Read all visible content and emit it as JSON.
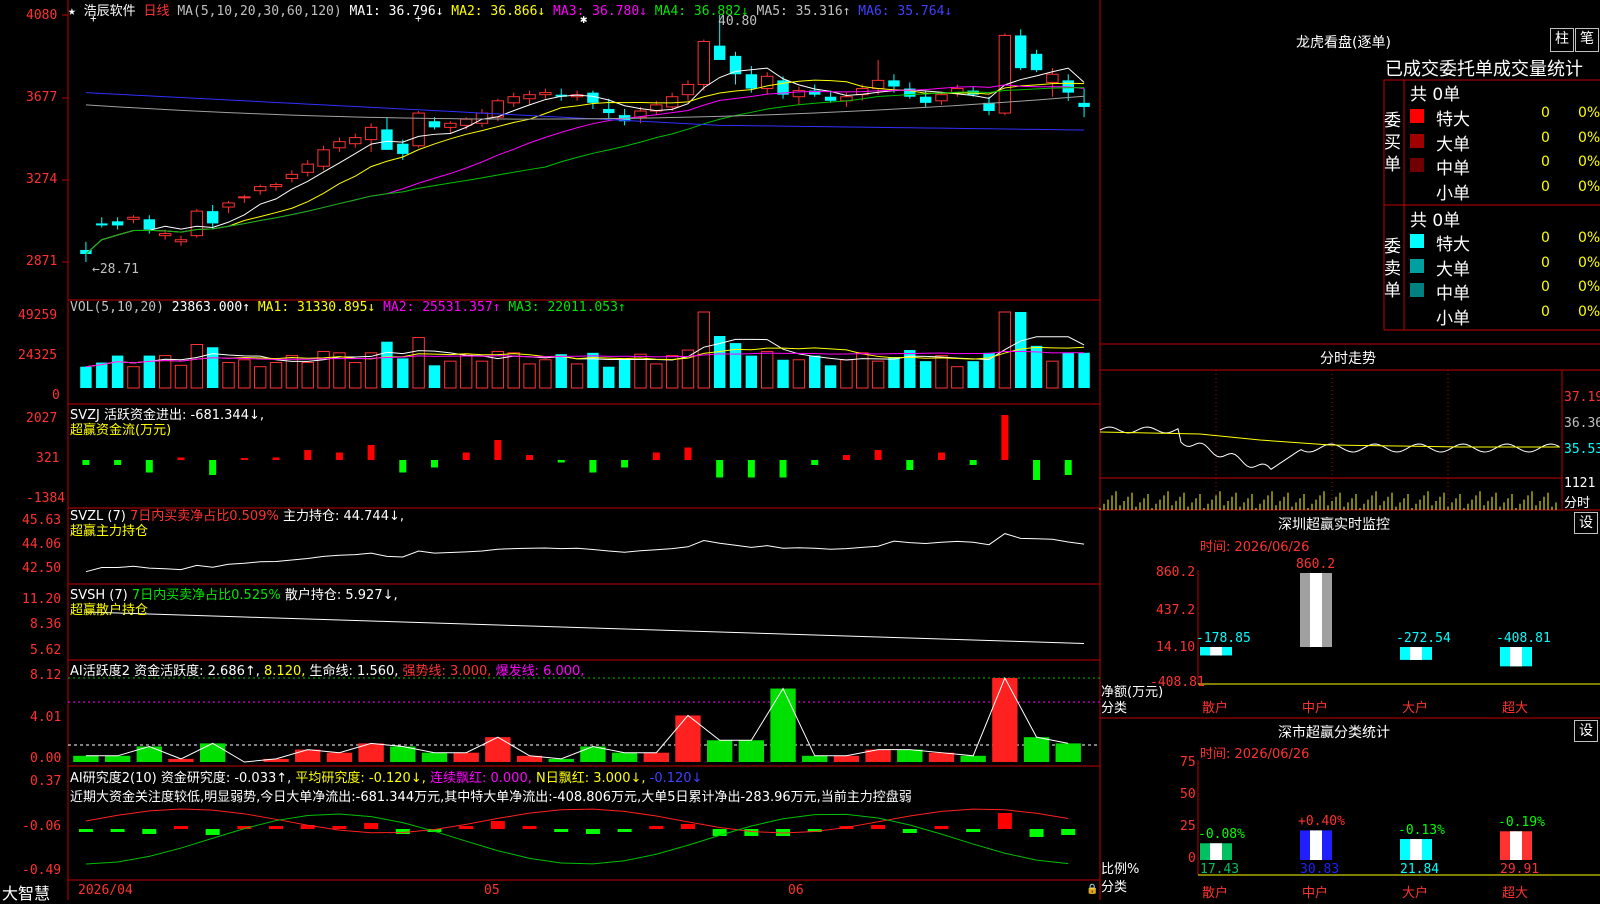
{
  "stock": {
    "name": "浩辰软件",
    "period": "日线",
    "star": "★",
    "star2": "✱"
  },
  "ma_bar": {
    "label": "MA(5,10,20,30,60,120)",
    "ma1": "MA1: 36.796↓",
    "ma2": "MA2: 36.866↓",
    "ma3": "MA3: 36.780↓",
    "ma4": "MA4: 36.882↓",
    "ma5": "MA5: 35.316↑",
    "ma6": "MA6: 35.764↓"
  },
  "price_axis": [
    "4080",
    "3677",
    "3274",
    "2871"
  ],
  "price_marks": {
    "high": "40.80",
    "low": "28.71"
  },
  "vol": {
    "label": "VOL(5,10,20)",
    "value": "23863.000↑",
    "ma1": "MA1: 31330.895↓",
    "ma2": "MA2: 25531.357↑",
    "ma3": "MA3: 22011.053↑",
    "axis": [
      "49259",
      "24325",
      "0"
    ]
  },
  "svzj": {
    "label": "SVZJ  活跃资金进出: -681.344↓,",
    "sub": "超赢资金流(万元)",
    "axis": [
      "2027",
      "321",
      "-1384"
    ]
  },
  "svzl": {
    "label": "SVZL (7)",
    "p1": "7日内买卖净占比0.509%",
    "p2": "主力持仓: 44.744↓,",
    "sub": "超赢主力持仓",
    "axis": [
      "45.63",
      "44.06",
      "42.50"
    ]
  },
  "svsh": {
    "label": "SVSH (7)",
    "p1": "7日内买卖净占比0.525%",
    "p2": "散户持仓: 5.927↓,",
    "sub": "超赢散户持仓",
    "axis": [
      "11.20",
      "8.36",
      "5.62"
    ]
  },
  "ai_active": {
    "label": "AI活跃度2 资金活跃度: 2.686↑,",
    "v2": "8.120,",
    "v3": "生命线: 1.560,",
    "v4": "强势线: 3.000,",
    "v5": "爆发线: 6.000,",
    "axis": [
      "8.12",
      "4.01",
      "0.00"
    ]
  },
  "ai_research": {
    "label": "AI研究度2(10) 资金研究度: -0.033↑,",
    "v2": "平均研究度: -0.120↓,",
    "v3": "连续飘红: 0.000,",
    "v4": "N日飘红: 3.000↓,",
    "v5": "-0.120↓",
    "summary": "近期大资金关注度较低,明显弱势,今日大单净流出:-681.344万元,其中特大单净流出:-408.806万元,大单5日累计净出-283.96万元,当前主力控盘弱",
    "axis": [
      "0.37",
      "-0.06",
      "-0.49"
    ]
  },
  "dates": {
    "d1": "2026/04",
    "d2": "05",
    "d3": "06"
  },
  "brand": "大智慧",
  "right": {
    "lh_title": "龙虎看盘(逐单)",
    "btn_zhu": "柱",
    "btn_bi": "笔",
    "header": "已成交委托单成交量统计",
    "buy": {
      "side": "委买单",
      "count": "共 0单",
      "rows": [
        {
          "name": "特大",
          "v": "0",
          "p": "0%",
          "c": "#ff0000"
        },
        {
          "name": "大单",
          "v": "0",
          "p": "0%",
          "c": "#a00000"
        },
        {
          "name": "中单",
          "v": "0",
          "p": "0%",
          "c": "#700000"
        },
        {
          "name": "小单",
          "v": "0",
          "p": "0%",
          "c": ""
        }
      ]
    },
    "sell": {
      "side": "委卖单",
      "count": "共 0单",
      "rows": [
        {
          "name": "特大",
          "v": "0",
          "p": "0%",
          "c": "#00ffff"
        },
        {
          "name": "大单",
          "v": "0",
          "p": "0%",
          "c": "#00a0a0"
        },
        {
          "name": "中单",
          "v": "0",
          "p": "0%",
          "c": "#008080"
        },
        {
          "name": "小单",
          "v": "0",
          "p": "0%",
          "c": ""
        }
      ]
    },
    "fs": {
      "title": "分时走势",
      "axis": [
        "37.19",
        "36.36",
        "35.53"
      ],
      "vol": "1121",
      "vol_unit": "分时"
    },
    "sz": {
      "title": "深圳超赢实时监控",
      "btn": "设",
      "time": "时间: 2026/06/26",
      "axis": [
        "860.2",
        "437.2",
        "14.10",
        "-408.81"
      ],
      "ylabel": "净额(万元)",
      "xlabel": "分类",
      "cats": [
        "散户",
        "中户",
        "大户",
        "超大"
      ],
      "values": [
        "-178.85",
        "860.2",
        "-272.54",
        "-408.81"
      ]
    },
    "sc": {
      "title": "深市超赢分类统计",
      "btn": "设",
      "time": "时间: 2026/06/26",
      "axis": [
        "75",
        "50",
        "25",
        "0"
      ],
      "ylabel": "比例%",
      "xlabel": "分类",
      "cats": [
        "散户",
        "中户",
        "大户",
        "超大"
      ],
      "chg": [
        "-0.08%",
        "+0.40%",
        "-0.13%",
        "-0.19%"
      ],
      "vals": [
        "17.43",
        "30.83",
        "21.84",
        "29.91"
      ]
    }
  },
  "chart_data": {
    "type": "candlestick",
    "title": "浩辰软件 日线",
    "ylim": [
      28.71,
      40.8
    ],
    "candles": [
      [
        29.3,
        29.7,
        28.71,
        29.1
      ],
      [
        30.6,
        30.9,
        30.4,
        30.5
      ],
      [
        30.7,
        30.9,
        30.3,
        30.5
      ],
      [
        30.8,
        31.0,
        30.6,
        30.9
      ],
      [
        30.8,
        31.0,
        30.1,
        30.3
      ],
      [
        30.0,
        30.3,
        29.8,
        30.1
      ],
      [
        29.7,
        30.0,
        29.5,
        29.8
      ],
      [
        30.0,
        31.3,
        29.9,
        31.2
      ],
      [
        31.2,
        31.5,
        30.3,
        30.6
      ],
      [
        31.4,
        31.7,
        31.1,
        31.6
      ],
      [
        31.9,
        32.0,
        31.6,
        31.9
      ],
      [
        32.2,
        32.5,
        32.0,
        32.4
      ],
      [
        32.4,
        32.6,
        32.2,
        32.5
      ],
      [
        32.8,
        33.2,
        32.6,
        33.0
      ],
      [
        33.1,
        33.7,
        32.9,
        33.5
      ],
      [
        33.4,
        34.4,
        33.2,
        34.2
      ],
      [
        34.3,
        34.8,
        34.1,
        34.6
      ],
      [
        34.5,
        35.0,
        34.3,
        34.8
      ],
      [
        34.7,
        35.5,
        34.1,
        35.3
      ],
      [
        35.2,
        35.8,
        34.3,
        34.2
      ],
      [
        34.5,
        34.7,
        33.7,
        34.0
      ],
      [
        34.4,
        36.1,
        34.3,
        36.0
      ],
      [
        35.6,
        35.8,
        35.2,
        35.3
      ],
      [
        35.3,
        35.6,
        35.0,
        35.5
      ],
      [
        35.4,
        35.8,
        35.2,
        35.7
      ],
      [
        35.5,
        36.2,
        35.3,
        36.0
      ],
      [
        35.8,
        36.7,
        35.6,
        36.6
      ],
      [
        36.5,
        37.0,
        36.3,
        36.8
      ],
      [
        36.7,
        37.1,
        36.4,
        36.9
      ],
      [
        36.9,
        37.2,
        36.7,
        37.0
      ],
      [
        36.9,
        37.2,
        36.6,
        36.8
      ],
      [
        36.8,
        37.1,
        36.6,
        36.9
      ],
      [
        37.0,
        37.1,
        36.2,
        36.5
      ],
      [
        36.2,
        36.7,
        35.7,
        36.0
      ],
      [
        35.9,
        36.2,
        35.4,
        35.6
      ],
      [
        35.8,
        36.3,
        35.5,
        36.1
      ],
      [
        36.1,
        36.6,
        35.9,
        36.4
      ],
      [
        36.3,
        37.0,
        36.1,
        36.8
      ],
      [
        36.9,
        37.6,
        36.6,
        37.4
      ],
      [
        37.4,
        39.6,
        37.1,
        39.5
      ],
      [
        39.3,
        40.8,
        38.8,
        38.6
      ],
      [
        38.8,
        39.0,
        37.4,
        37.9
      ],
      [
        37.9,
        38.3,
        37.0,
        37.2
      ],
      [
        37.2,
        38.0,
        36.9,
        37.8
      ],
      [
        37.6,
        37.8,
        36.7,
        36.9
      ],
      [
        36.8,
        37.3,
        36.4,
        37.1
      ],
      [
        37.1,
        37.4,
        36.8,
        36.9
      ],
      [
        36.8,
        37.1,
        36.5,
        36.6
      ],
      [
        36.6,
        37.0,
        36.3,
        36.8
      ],
      [
        36.9,
        37.4,
        36.6,
        37.2
      ],
      [
        37.2,
        38.6,
        36.9,
        37.6
      ],
      [
        37.6,
        37.9,
        37.0,
        37.3
      ],
      [
        37.2,
        37.5,
        36.7,
        36.8
      ],
      [
        36.8,
        37.1,
        36.3,
        36.5
      ],
      [
        36.6,
        37.0,
        36.4,
        36.9
      ],
      [
        37.0,
        37.4,
        36.8,
        37.2
      ],
      [
        37.1,
        37.3,
        36.8,
        36.9
      ],
      [
        36.5,
        36.8,
        35.9,
        36.1
      ],
      [
        36.0,
        39.9,
        35.9,
        39.8
      ],
      [
        39.8,
        40.1,
        38.1,
        38.2
      ],
      [
        38.9,
        39.1,
        38.0,
        38.1
      ],
      [
        37.5,
        38.2,
        36.8,
        37.9
      ],
      [
        37.6,
        37.9,
        36.6,
        37.0
      ],
      [
        36.5,
        37.2,
        35.8,
        36.3
      ]
    ]
  }
}
